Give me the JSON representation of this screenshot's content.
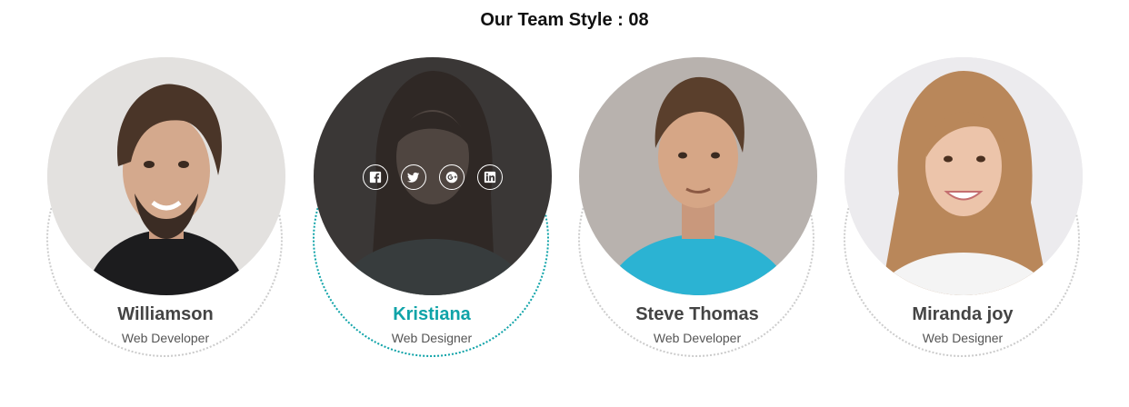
{
  "section": {
    "title": "Our Team Style : 08"
  },
  "colors": {
    "accent": "#0fa3a8",
    "name_text": "#444444",
    "role_text": "#555555",
    "ring": "#cccccc",
    "overlay": "#282626"
  },
  "members": [
    {
      "name": "Williamson",
      "role": "Web Developer",
      "photo_icon": "man-portrait"
    },
    {
      "name": "Kristiana",
      "role": "Web Designer",
      "photo_icon": "woman-portrait",
      "hovered": true,
      "social_icons": [
        "facebook-icon",
        "twitter-icon",
        "google-plus-icon",
        "linkedin-icon"
      ]
    },
    {
      "name": "Steve Thomas",
      "role": "Web Developer",
      "photo_icon": "man-portrait"
    },
    {
      "name": "Miranda joy",
      "role": "Web Designer",
      "photo_icon": "woman-portrait"
    }
  ]
}
